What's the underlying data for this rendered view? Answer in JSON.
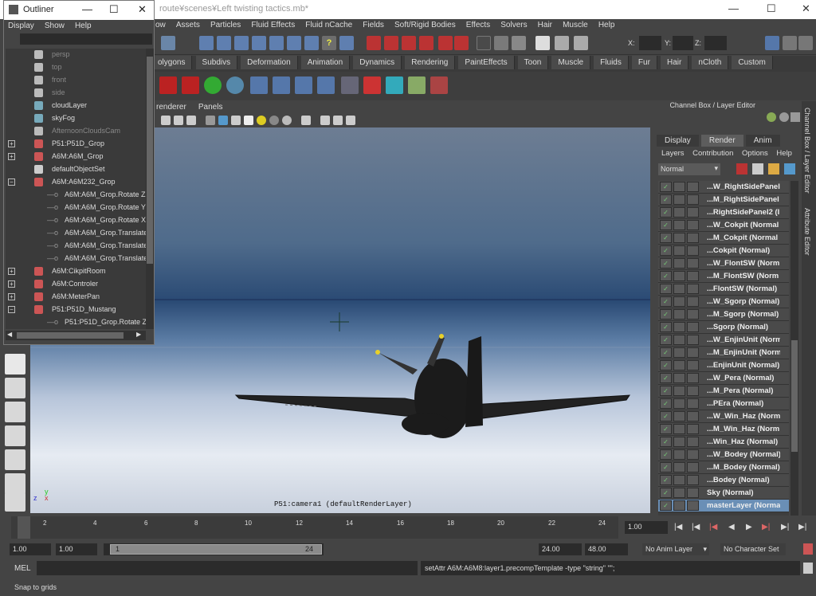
{
  "main_window": {
    "title": "route¥scenes¥Left twisting tactics.mb*",
    "minimize": "—",
    "maximize": "☐",
    "close": "✕"
  },
  "menubar": [
    "ow",
    "Assets",
    "Particles",
    "Fluid Effects",
    "Fluid nCache",
    "Fields",
    "Soft/Rigid Bodies",
    "Effects",
    "Solvers",
    "Hair",
    "Muscle",
    "Help"
  ],
  "status_line": {
    "x_label": "X:",
    "y_label": "Y:",
    "z_label": "Z:"
  },
  "shelf_tabs": [
    "olygons",
    "Subdivs",
    "Deformation",
    "Animation",
    "Dynamics",
    "Rendering",
    "PaintEffects",
    "Toon",
    "Muscle",
    "Fluids",
    "Fur",
    "Hair",
    "nCloth",
    "Custom"
  ],
  "panel_menu": [
    "renderer",
    "Panels"
  ],
  "viewport": {
    "hud_camera": "P51:camera1 (defaultRenderLayer)",
    "axis_y": "y",
    "axis_z": "z",
    "axis_x": "x"
  },
  "channel_box": {
    "title": "Channel Box / Layer Editor",
    "tabs": [
      "Display",
      "Render",
      "Anim"
    ],
    "active_tab": "Render",
    "menu": [
      "Layers",
      "Contribution",
      "Options",
      "Help"
    ],
    "blend_mode": "Normal",
    "layers": [
      "...W_RightSidePanel",
      "...M_RightSidePanel",
      "...RightSidePanel2 (I",
      "...W_Cokpit (Normal",
      "...M_Cokpit (Normal",
      "...Cokpit (Normal)",
      "...W_FlontSW (Norm",
      "...M_FlontSW (Norm",
      "...FlontSW (Normal)",
      "...W_Sgorp (Normal)",
      "...M_Sgorp (Normal)",
      "...Sgorp (Normal)",
      "...W_EnjinUnit (Norm",
      "...M_EnjinUnit (Norm",
      "...EnjinUnit (Normal)",
      "...W_Pera (Normal)",
      "...M_Pera (Normal)",
      "...PEra (Normal)",
      "...W_Win_Haz (Norm",
      "...M_Win_Haz (Norm",
      "...Win_Haz (Normal)",
      "...W_Bodey (Normal)",
      "...M_Bodey (Normal)",
      "...Bodey (Normal)",
      "Sky (Normal)",
      "masterLayer (Norma"
    ],
    "selected_layer": "masterLayer (Norma"
  },
  "right_tabs": [
    "Channel Box / Layer Editor",
    "Attribute Editor"
  ],
  "time_slider": {
    "ticks": [
      "2",
      "4",
      "6",
      "8",
      "10",
      "12",
      "14",
      "16",
      "18",
      "20",
      "22",
      "24"
    ],
    "current_frame_marker": "1",
    "current_time": "1.00"
  },
  "range_slider": {
    "start_time": "1.00",
    "playback_start": "1.00",
    "range_start": "1",
    "range_end": "24",
    "playback_end": "24.00",
    "end_time": "48.00",
    "anim_layer": "No Anim Layer",
    "character_set": "No Character Set"
  },
  "command_line": {
    "label": "MEL",
    "result": "setAttr A6M:A6M8:layer1.precompTemplate -type \"string\" \"\";"
  },
  "help_line": "Snap to grids",
  "outliner": {
    "title": "Outliner",
    "menu": [
      "Display",
      "Show",
      "Help"
    ],
    "items": [
      {
        "label": "persp",
        "dim": true,
        "indent": 0,
        "exp": ""
      },
      {
        "label": "top",
        "dim": true,
        "indent": 0,
        "exp": ""
      },
      {
        "label": "front",
        "dim": true,
        "indent": 0,
        "exp": ""
      },
      {
        "label": "side",
        "dim": true,
        "indent": 0,
        "exp": ""
      },
      {
        "label": "cloudLayer",
        "dim": false,
        "indent": 0,
        "exp": ""
      },
      {
        "label": "skyFog",
        "dim": false,
        "indent": 0,
        "exp": ""
      },
      {
        "label": "AfternoonCloudsCam",
        "dim": true,
        "indent": 0,
        "exp": ""
      },
      {
        "label": "P51:P51D_Grop",
        "dim": false,
        "indent": 0,
        "exp": "+"
      },
      {
        "label": "A6M:A6M_Grop",
        "dim": false,
        "indent": 0,
        "exp": "+"
      },
      {
        "label": "defaultObjectSet",
        "dim": false,
        "indent": 0,
        "exp": ""
      },
      {
        "label": "A6M:A6M232_Grop",
        "dim": false,
        "indent": 0,
        "exp": "−"
      },
      {
        "label": "A6M:A6M_Grop.Rotate Z",
        "dim": false,
        "indent": 1,
        "exp": ""
      },
      {
        "label": "A6M:A6M_Grop.Rotate Y",
        "dim": false,
        "indent": 1,
        "exp": ""
      },
      {
        "label": "A6M:A6M_Grop.Rotate X",
        "dim": false,
        "indent": 1,
        "exp": ""
      },
      {
        "label": "A6M:A6M_Grop.Translate",
        "dim": false,
        "indent": 1,
        "exp": ""
      },
      {
        "label": "A6M:A6M_Grop.Translate",
        "dim": false,
        "indent": 1,
        "exp": ""
      },
      {
        "label": "A6M:A6M_Grop.Translate",
        "dim": false,
        "indent": 1,
        "exp": ""
      },
      {
        "label": "A6M:CikpitRoom",
        "dim": false,
        "indent": 0,
        "exp": "+"
      },
      {
        "label": "A6M:Controler",
        "dim": false,
        "indent": 0,
        "exp": "+"
      },
      {
        "label": "A6M:MeterPan",
        "dim": false,
        "indent": 0,
        "exp": "+"
      },
      {
        "label": "P51:P51D_Mustang",
        "dim": false,
        "indent": 0,
        "exp": "−"
      },
      {
        "label": "P51:P51D_Grop.Rotate Z",
        "dim": false,
        "indent": 1,
        "exp": ""
      }
    ]
  },
  "colors": {
    "maya_bg": "#444444",
    "selection": "#6a8fb6"
  }
}
